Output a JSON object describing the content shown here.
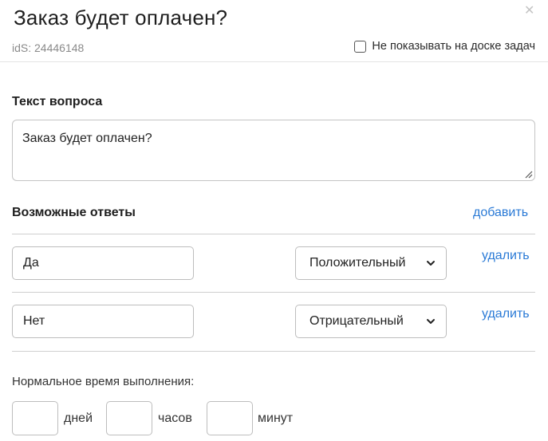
{
  "modal": {
    "title": "Заказ будет оплачен?",
    "ids_label": "idS: 24446148",
    "hide_on_board_label": "Не показывать на доске задач"
  },
  "question": {
    "section_label": "Текст вопроса",
    "text": "Заказ будет оплачен?"
  },
  "answers": {
    "section_label": "Возможные ответы",
    "add_label": "добавить",
    "items": [
      {
        "text": "Да",
        "type": "Положительный",
        "delete_label": "удалить"
      },
      {
        "text": "Нет",
        "type": "Отрицательный",
        "delete_label": "удалить"
      }
    ]
  },
  "normal_time": {
    "label": "Нормальное время выполнения:",
    "days_value": "",
    "days_unit": "дней",
    "hours_value": "",
    "hours_unit": "часов",
    "minutes_value": "",
    "minutes_unit": "минут"
  },
  "colors": {
    "link": "#2a7ad6",
    "border": "#bdbdbd",
    "muted_text": "#8a8a8a"
  }
}
